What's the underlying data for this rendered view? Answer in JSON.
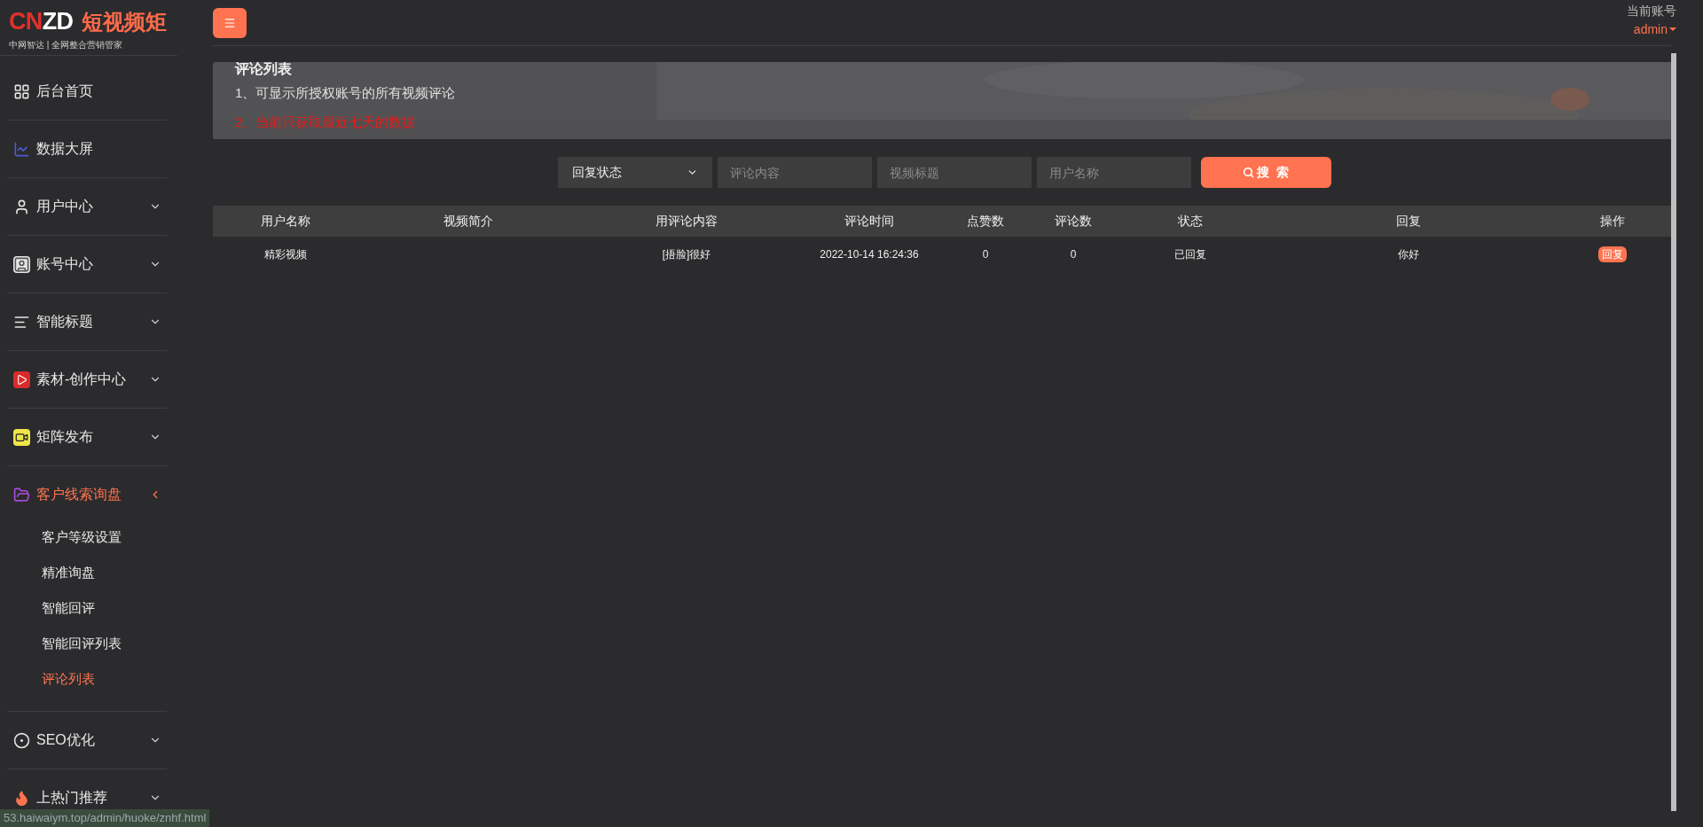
{
  "logo": {
    "mark_first": "CN",
    "mark_second": "ZD",
    "tagline": "中网智达 | 全网整合营销管家",
    "title": "短视频矩"
  },
  "sidebar": {
    "items": [
      {
        "label": "后台首页",
        "kind": "link",
        "selected": false
      },
      {
        "label": "数据大屏",
        "kind": "link",
        "selected": false
      },
      {
        "label": "用户中心",
        "kind": "group",
        "expanded": false,
        "selected": false
      },
      {
        "label": "账号中心",
        "kind": "group",
        "expanded": false,
        "selected": false
      },
      {
        "label": "智能标题",
        "kind": "group",
        "expanded": false,
        "selected": false
      },
      {
        "label": "素材-创作中心",
        "kind": "group",
        "expanded": false,
        "selected": false
      },
      {
        "label": "矩阵发布",
        "kind": "group",
        "expanded": false,
        "selected": false
      },
      {
        "label": "客户线索询盘",
        "kind": "group",
        "expanded": true,
        "selected": true,
        "children": [
          {
            "label": "客户等级设置",
            "selected": false
          },
          {
            "label": "精准询盘",
            "selected": false
          },
          {
            "label": "智能回评",
            "selected": false
          },
          {
            "label": "智能回评列表",
            "selected": false
          },
          {
            "label": "评论列表",
            "selected": true
          }
        ]
      },
      {
        "label": "SEO优化",
        "kind": "group",
        "expanded": false,
        "selected": false
      },
      {
        "label": "上热门推荐",
        "kind": "group",
        "expanded": false,
        "selected": false
      }
    ]
  },
  "header": {
    "account_label": "当前账号",
    "account": "admin"
  },
  "notice": {
    "title": "评论列表",
    "lines": [
      {
        "text": "1、可显示所授权账号的所有视频评论",
        "kind": "note"
      },
      {
        "text": "2、当前只获取最近七天的数据",
        "kind": "warning"
      }
    ]
  },
  "filters": {
    "select": {
      "value": "回复状态"
    },
    "fields": [
      {
        "placeholder": "评论内容"
      },
      {
        "placeholder": "视频标题"
      },
      {
        "placeholder": "用户名称"
      }
    ],
    "search_button": "搜  索"
  },
  "table": {
    "columns": [
      "用户名称",
      "视频简介",
      "用评论内容",
      "评论时间",
      "点赞数",
      "评论数",
      "状态",
      "回复",
      "操作"
    ],
    "rows": [
      {
        "cells": [
          "精彩视频",
          "",
          "[捂脸]很好",
          "2022-10-14 16:24:36",
          "0",
          "0",
          "已回复",
          "你好"
        ],
        "action": "回复"
      }
    ]
  },
  "status_bar": {
    "url": "53.haiwaiym.top/admin/huoke/znhf.html"
  }
}
